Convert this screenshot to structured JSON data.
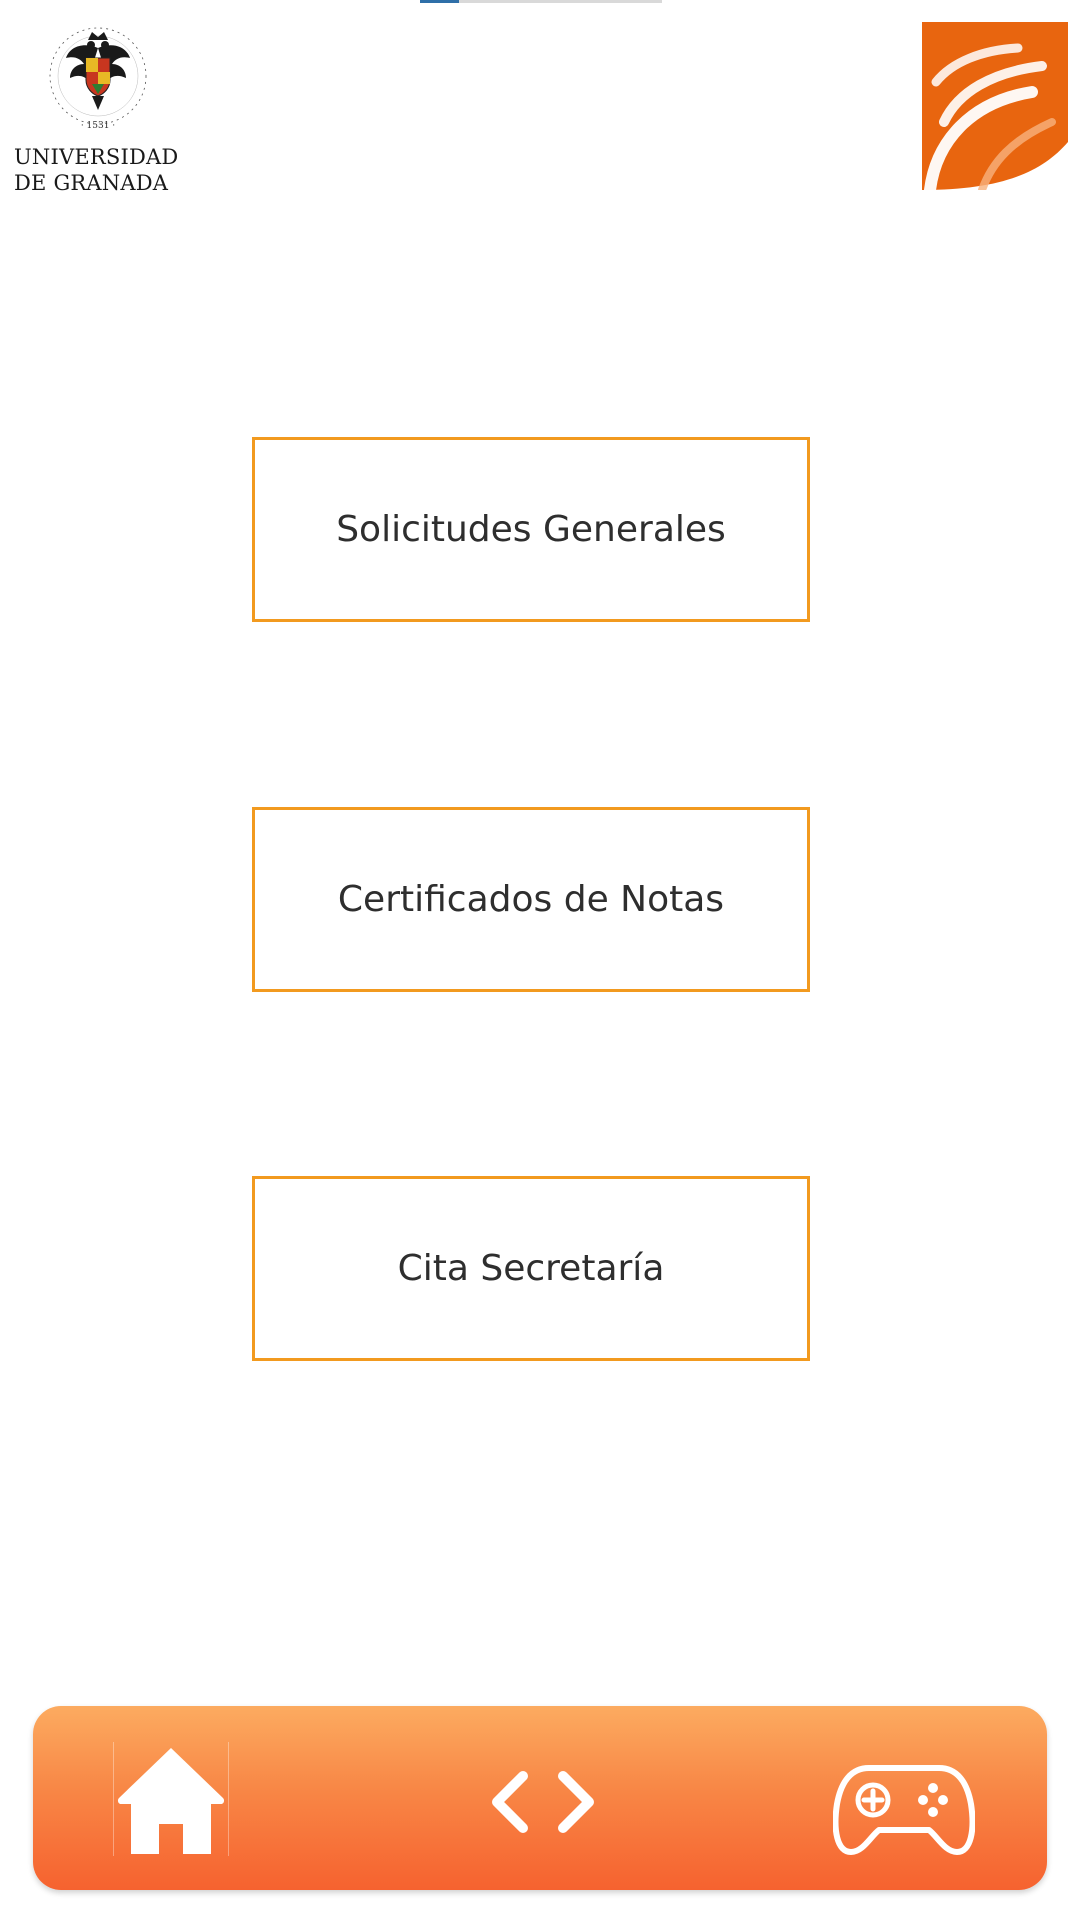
{
  "header": {
    "university_logo_icon": "university-crest-icon",
    "university_name_line1": "UNIVERSIDAD",
    "university_name_line2": "DE GRANADA",
    "brand_logo_icon": "orange-wave-logo-icon"
  },
  "menu": {
    "items": [
      {
        "label": "Solicitudes Generales"
      },
      {
        "label": "Certificados de Notas"
      },
      {
        "label": "Cita Secretaría"
      }
    ]
  },
  "bottom_nav": {
    "items": [
      {
        "icon": "home-icon"
      },
      {
        "icon": "code-brackets-icon"
      },
      {
        "icon": "gamepad-icon"
      }
    ]
  },
  "colors": {
    "button_border": "#f29a1f",
    "nav_gradient_top": "#fcab60",
    "nav_gradient_bottom": "#f6622f",
    "brand_orange": "#e8650f",
    "text": "#2e2e2e"
  },
  "progress": {
    "fraction": 0.16
  }
}
